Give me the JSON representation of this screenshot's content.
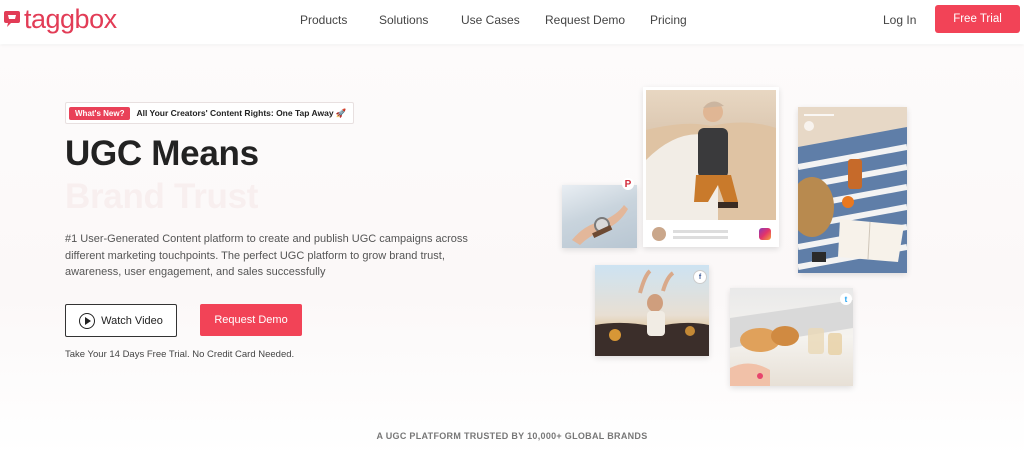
{
  "header": {
    "logo_text": "taggbox",
    "nav": [
      "Products",
      "Solutions",
      "Use Cases",
      "Request Demo",
      "Pricing"
    ],
    "login_label": "Log In",
    "cta_label": "Free Trial"
  },
  "hero": {
    "badge": "What's New?",
    "announcement": "All Your Creators' Content Rights: One Tap Away 🚀",
    "title": "UGC Means",
    "title_faded": "Brand Trust",
    "description": "#1 User-Generated Content platform to create and publish UGC campaigns across different marketing touchpoints. The perfect UGC platform to grow brand trust, awareness, user engagement, and sales successfully",
    "watch_label": "Watch Video",
    "demo_label": "Request Demo",
    "trial_note": "Take Your 14 Days Free Trial. No Credit Card Needed."
  },
  "trusted_text": "A UGC PLATFORM TRUSTED BY 10,000+ GLOBAL BRANDS",
  "colors": {
    "brand": "#e23c56",
    "cta": "#f24357"
  },
  "icons": [
    "play-icon",
    "pinterest-icon",
    "instagram-icon",
    "facebook-icon",
    "twitter-icon"
  ]
}
